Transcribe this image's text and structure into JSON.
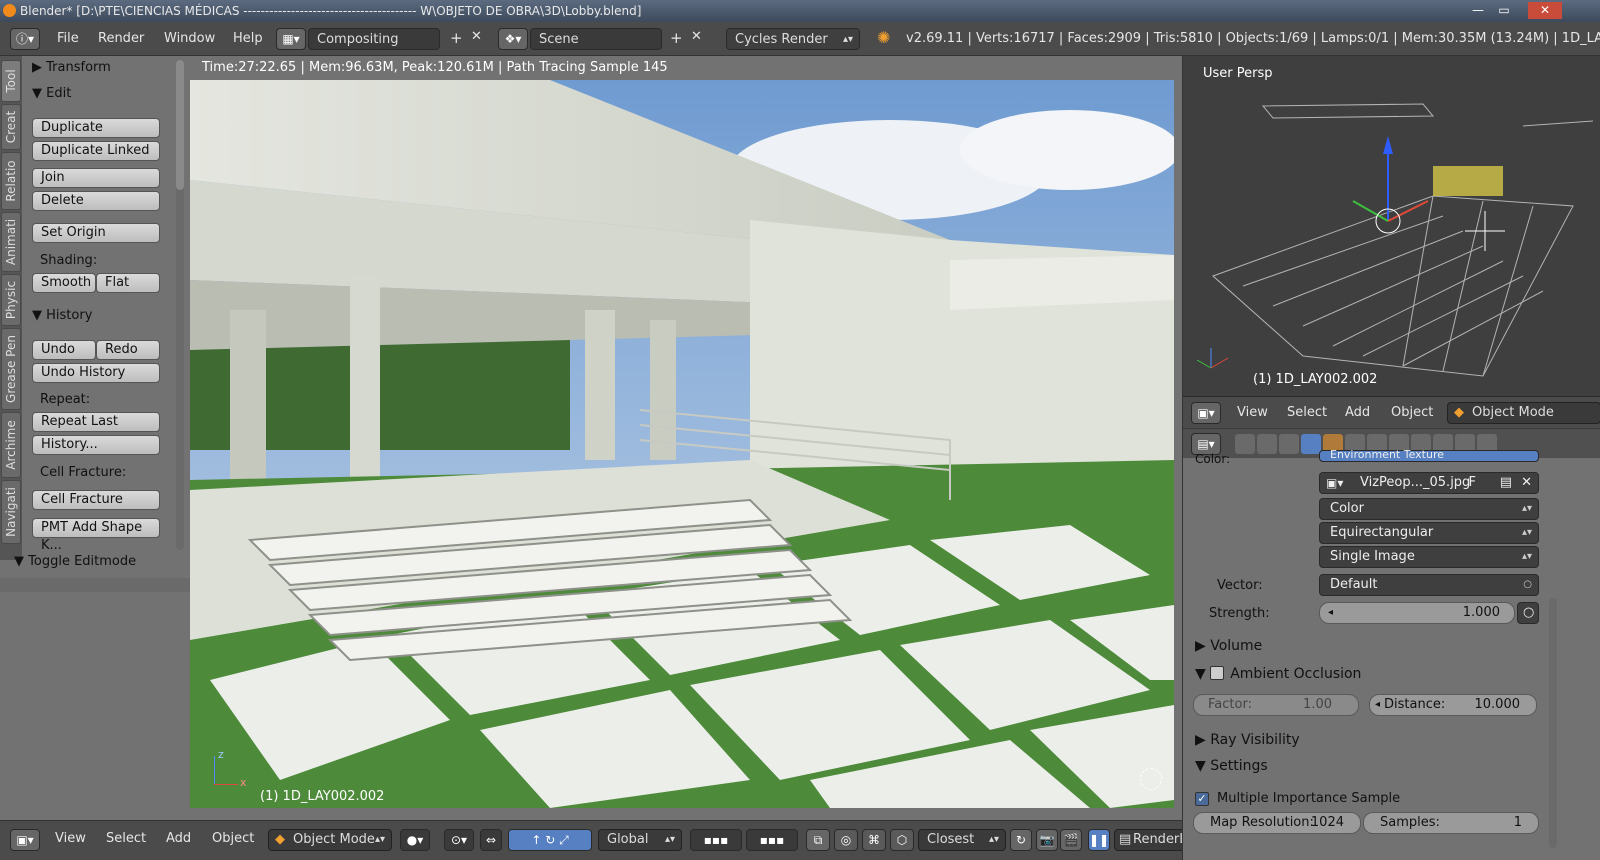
{
  "window": {
    "title": "Blender* [D:\\PTE\\CIENCIAS MÉDICAS ---------------------------------------- W\\OBJETO DE OBRA\\3D\\Lobby.blend]",
    "minimize": "—",
    "maximize": "▭",
    "close": "✕"
  },
  "topbar": {
    "menus": [
      "File",
      "Render",
      "Window",
      "Help"
    ],
    "layout": "Compositing",
    "scene": "Scene",
    "engine": "Cycles Render",
    "stats": "v2.69.11 | Verts:16717 | Faces:2909 | Tris:5810 | Objects:1/69 | Lamps:0/1 | Mem:30.35M (13.24M) | 1D_LAY"
  },
  "sidetabs": [
    "Tool",
    "Creat",
    "Relatio",
    "Animati",
    "Physic",
    "Grease Pen",
    "Archime",
    "Navigati"
  ],
  "toolshelf": {
    "transform": "Transform",
    "edit": "Edit",
    "duplicate": "Duplicate",
    "duplicate_linked": "Duplicate Linked",
    "join": "Join",
    "delete": "Delete",
    "set_origin": "Set Origin",
    "shading": "Shading:",
    "smooth": "Smooth",
    "flat": "Flat",
    "history": "History",
    "undo": "Undo",
    "redo": "Redo",
    "undo_history": "Undo History",
    "repeat": "Repeat:",
    "repeat_last": "Repeat Last",
    "history_btn": "History...",
    "cell_fracture_label": "Cell Fracture:",
    "cell_fracture": "Cell Fracture",
    "pmt": "PMT Add Shape K...",
    "toggle_editmode": "Toggle Editmode"
  },
  "viewport": {
    "info": "Time:27:22.65 | Mem:96.63M, Peak:120.61M | Path Tracing Sample 145",
    "object": "(1) 1D_LAY002.002",
    "axis_z": "z",
    "axis_x": "x"
  },
  "bottombar": {
    "menus": [
      "View",
      "Select",
      "Add",
      "Object"
    ],
    "mode": "Object Mode",
    "orientation": "Global",
    "snap": "Closest",
    "render_layer": "RenderL"
  },
  "miniview": {
    "label": "User Persp",
    "object": "(1) 1D_LAY002.002"
  },
  "rightheader": {
    "menus": [
      "View",
      "Select",
      "Add",
      "Object"
    ],
    "mode": "Object Mode"
  },
  "properties": {
    "color_label": "Color:",
    "env_texture": "Environment Texture",
    "image": "VizPeop..._05.jpg",
    "fake": "F",
    "color_space": "Color",
    "projection": "Equirectangular",
    "source": "Single Image",
    "vector_label": "Vector:",
    "vector_value": "Default",
    "strength_label": "Strength:",
    "strength_value": "1.000",
    "volume": "Volume",
    "ambient_occlusion": "Ambient Occlusion",
    "factor_label": "Factor:",
    "factor_value": "1.00",
    "distance_label": "Distance:",
    "distance_value": "10.000",
    "ray_visibility": "Ray Visibility",
    "settings": "Settings",
    "mis": "Multiple Importance Sample",
    "map_res_label": "Map Resolution:",
    "map_res_value": "1024",
    "samples_label": "Samples:",
    "samples_value": "1"
  },
  "colors": {
    "sky": "#7fa6d4",
    "grass": "#4d8a3a",
    "building": "#d8dcd2"
  }
}
